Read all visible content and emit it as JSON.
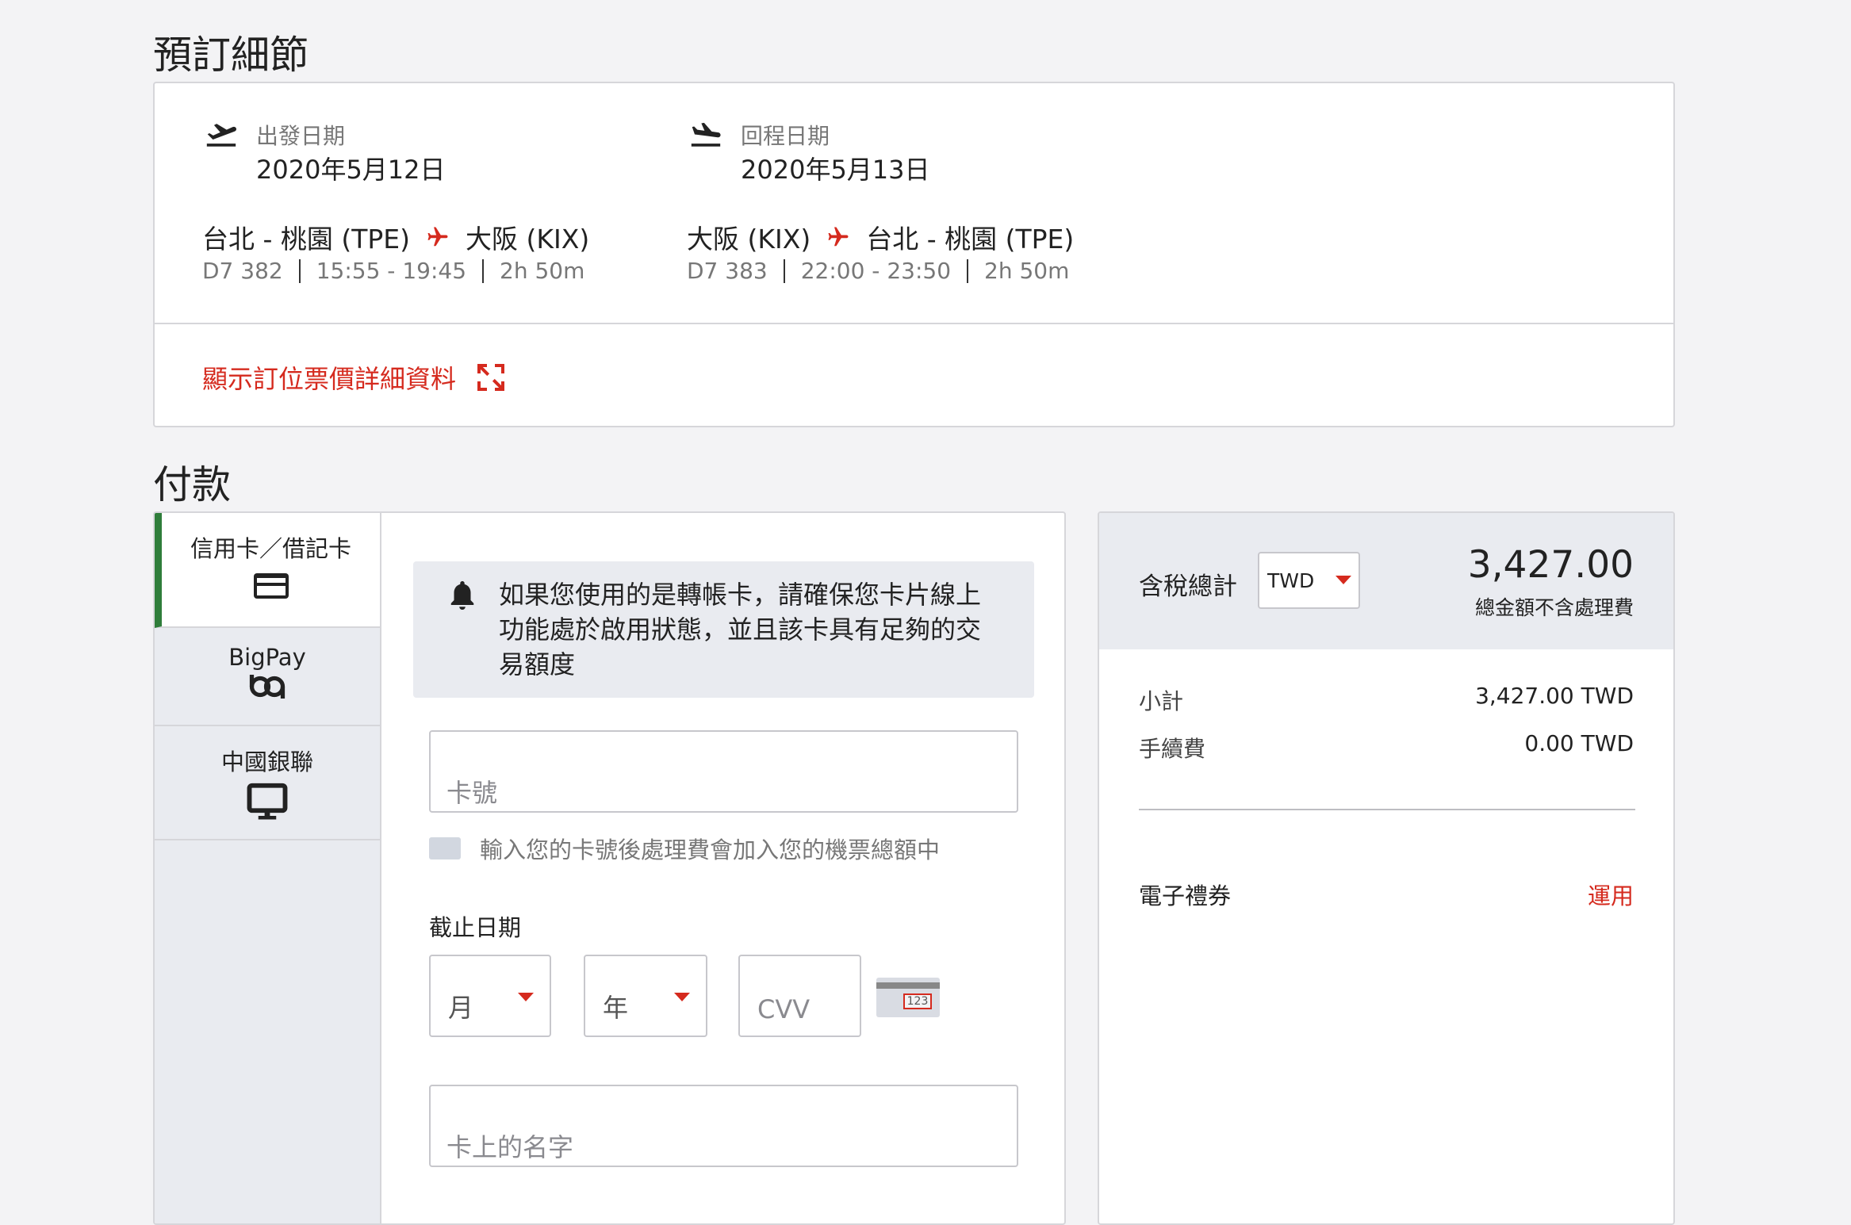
{
  "booking": {
    "title": "預訂細節",
    "outbound": {
      "date_label": "出發日期",
      "date": "2020年5月12日",
      "from": "台北 - 桃園 (TPE)",
      "to": "大阪 (KIX)",
      "flight_no": "D7 382",
      "time": "15:55 - 19:45",
      "duration": "2h 50m"
    },
    "return": {
      "date_label": "回程日期",
      "date": "2020年5月13日",
      "from": "大阪 (KIX)",
      "to": "台北 - 桃園 (TPE)",
      "flight_no": "D7 383",
      "time": "22:00 - 23:50",
      "duration": "2h 50m"
    },
    "details_link": "顯示訂位票價詳細資料"
  },
  "payment": {
    "title": "付款",
    "tabs": [
      {
        "label": "信用卡／借記卡",
        "icon": "credit-card-icon"
      },
      {
        "label": "BigPay",
        "icon": "bigpay-icon"
      },
      {
        "label": "中國銀聯",
        "icon": "monitor-icon"
      }
    ],
    "notice": "如果您使用的是轉帳卡，請確保您卡片線上功能處於啟用狀態，並且該卡具有足夠的交易額度",
    "card_number_placeholder": "卡號",
    "card_hint": "輸入您的卡號後處理費會加入您的機票總額中",
    "expiry_label": "截止日期",
    "month_placeholder": "月",
    "year_placeholder": "年",
    "cvv_placeholder": "CVV",
    "cvv_hint": "123",
    "name_placeholder": "卡上的名字"
  },
  "summary": {
    "total_label": "含稅總計",
    "currency": "TWD",
    "total_amount": "3,427.00",
    "total_note": "總金額不含處理費",
    "subtotal_label": "小計",
    "subtotal_value": "3,427.00 TWD",
    "fee_label": "手續費",
    "fee_value": "0.00 TWD",
    "voucher_label": "電子禮券",
    "voucher_action": "運用"
  },
  "colors": {
    "accent_red": "#d52a1e",
    "active_tab_green": "#2f7d3a",
    "background": "#f3f3f5"
  }
}
